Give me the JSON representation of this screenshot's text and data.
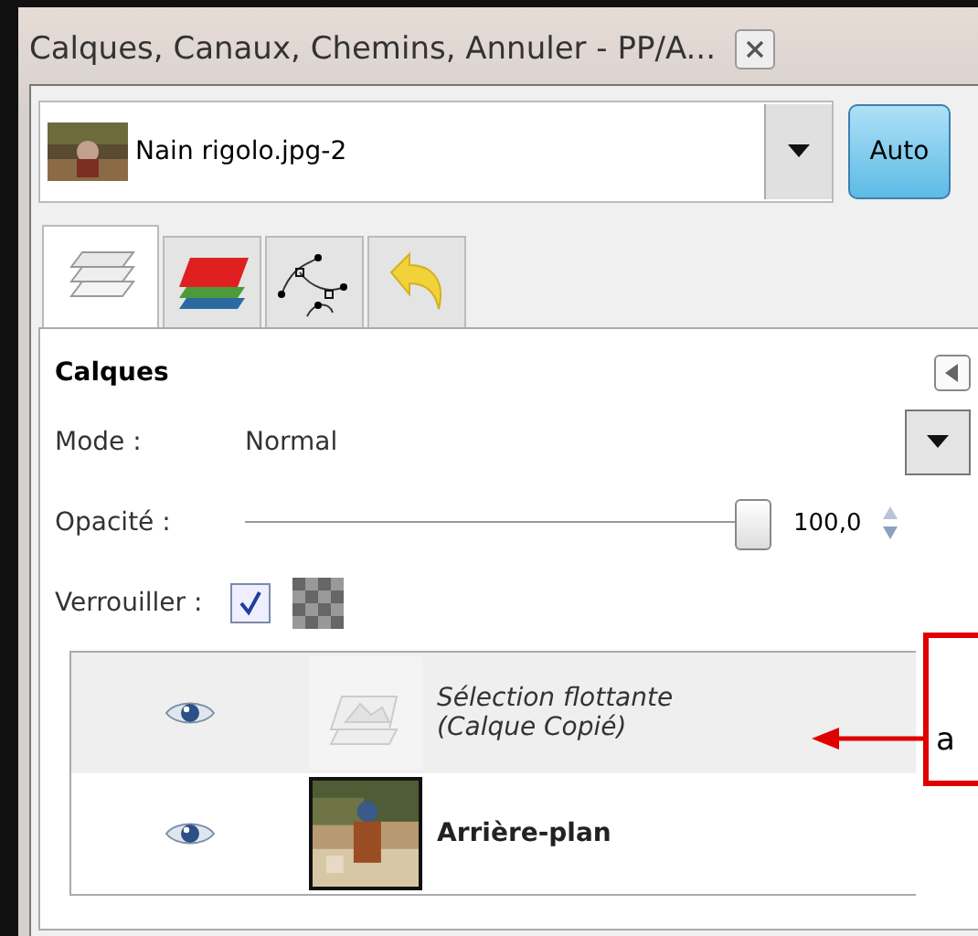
{
  "window": {
    "title": "Calques, Canaux, Chemins, Annuler - PP/A..."
  },
  "image_menu": {
    "value": "Nain rigolo.jpg-2",
    "auto_button": "Auto"
  },
  "tabs": [
    {
      "kind": "layers",
      "selected": true
    },
    {
      "kind": "channels",
      "selected": false
    },
    {
      "kind": "paths",
      "selected": false
    },
    {
      "kind": "undo",
      "selected": false
    }
  ],
  "panel": {
    "title": "Calques",
    "mode_label": "Mode :",
    "mode_value": "Normal",
    "opacity_label": "Opacité :",
    "opacity": {
      "level": 1,
      "reading": "100,0"
    },
    "lock_label": "Verrouiller :",
    "lock_pixels": {
      "checked": true
    }
  },
  "layers": [
    {
      "name": "Sélection flottante\n(Calque Copié)",
      "kind": "floating",
      "visible": true,
      "selected": true
    },
    {
      "name": "Arrière-plan",
      "kind": "normal",
      "visible": true,
      "selected": false
    }
  ],
  "callout": {
    "text": "a"
  }
}
